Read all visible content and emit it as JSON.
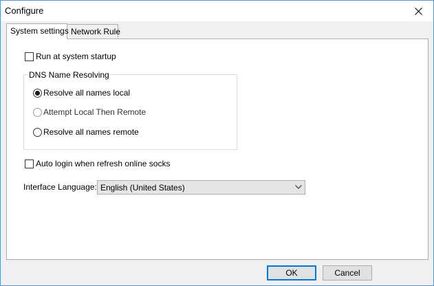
{
  "window": {
    "title": "Configure"
  },
  "tabs": [
    {
      "label": "System settings",
      "active": true
    },
    {
      "label": "Network Rule",
      "active": false
    }
  ],
  "settings": {
    "run_at_startup": {
      "label": "Run at system startup",
      "checked": false
    },
    "dns_group": {
      "title": "DNS Name Resolving",
      "options": [
        {
          "label": "Resolve all names local",
          "selected": true
        },
        {
          "label": "Attempt Local Then Remote",
          "selected": false
        },
        {
          "label": "Resolve all names remote",
          "selected": false
        }
      ]
    },
    "auto_login": {
      "label": "Auto login when refresh online socks",
      "checked": false
    },
    "language": {
      "label": "Interface Language:",
      "value": "English (United States)"
    }
  },
  "buttons": {
    "ok": "OK",
    "cancel": "Cancel"
  },
  "colors": {
    "accent": "#0078d7",
    "window_border": "#5a8fd0",
    "panel_bg": "#ffffff",
    "dialog_bg": "#f0f0f0"
  }
}
